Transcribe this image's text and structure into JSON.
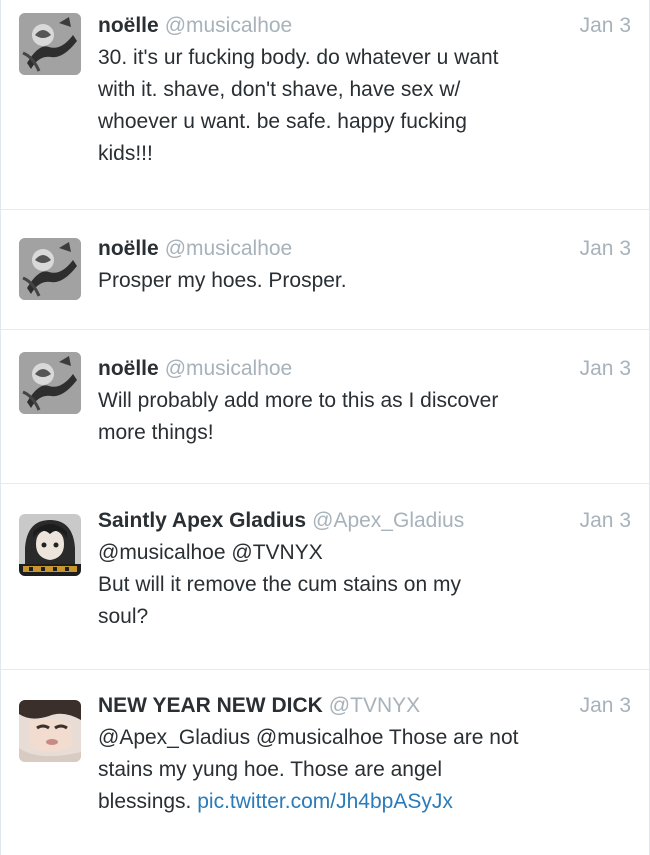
{
  "tweets": [
    {
      "name": "noëlle",
      "handle": "@musicalhoe",
      "time": "Jan 3",
      "avatar_icon": "rose-sketch-avatar",
      "lines": [
        "30. it's ur fucking body. do whatever u want",
        "with it. shave, don't shave, have sex w/",
        "whoever u want. be safe. happy fucking",
        "kids!!!"
      ]
    },
    {
      "name": "noëlle",
      "handle": "@musicalhoe",
      "time": "Jan 3",
      "avatar_icon": "rose-sketch-avatar",
      "lines": [
        "Prosper my hoes. Prosper."
      ]
    },
    {
      "name": "noëlle",
      "handle": "@musicalhoe",
      "time": "Jan 3",
      "avatar_icon": "rose-sketch-avatar",
      "lines": [
        "Will probably add more to this as I discover",
        "more things!"
      ]
    },
    {
      "name": "Saintly Apex Gladius",
      "handle": "@Apex_Gladius",
      "time": "Jan 3",
      "avatar_icon": "anime-character-avatar",
      "lines": [
        "@musicalhoe @TVNYX",
        "But will it remove the cum stains on my",
        "soul?"
      ]
    },
    {
      "name": "NEW YEAR NEW DICK",
      "handle": "@TVNYX",
      "time": "Jan 3",
      "avatar_icon": "selfie-avatar",
      "lines": [
        "@Apex_Gladius @musicalhoe Those are not",
        "stains my yung hoe. Those are angel",
        "blessings."
      ],
      "link": "pic.twitter.com/Jh4bpASyJx"
    }
  ]
}
